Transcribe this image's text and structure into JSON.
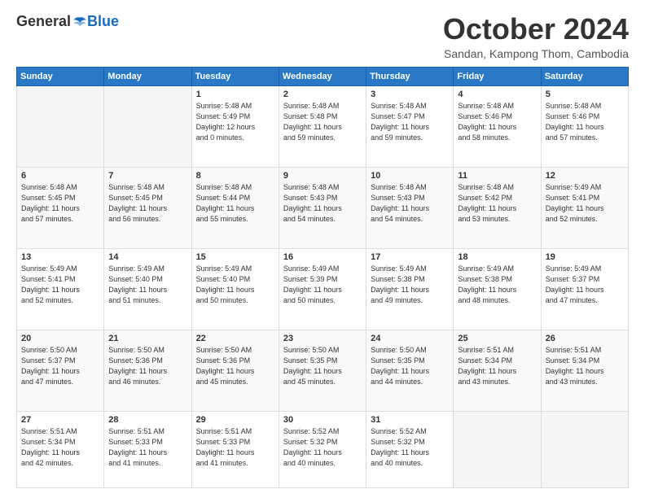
{
  "header": {
    "logo": {
      "general": "General",
      "blue": "Blue"
    },
    "title": "October 2024",
    "subtitle": "Sandan, Kampong Thom, Cambodia"
  },
  "weekdays": [
    "Sunday",
    "Monday",
    "Tuesday",
    "Wednesday",
    "Thursday",
    "Friday",
    "Saturday"
  ],
  "weeks": [
    [
      {
        "day": "",
        "info": ""
      },
      {
        "day": "",
        "info": ""
      },
      {
        "day": "1",
        "info": "Sunrise: 5:48 AM\nSunset: 5:49 PM\nDaylight: 12 hours\nand 0 minutes."
      },
      {
        "day": "2",
        "info": "Sunrise: 5:48 AM\nSunset: 5:48 PM\nDaylight: 11 hours\nand 59 minutes."
      },
      {
        "day": "3",
        "info": "Sunrise: 5:48 AM\nSunset: 5:47 PM\nDaylight: 11 hours\nand 59 minutes."
      },
      {
        "day": "4",
        "info": "Sunrise: 5:48 AM\nSunset: 5:46 PM\nDaylight: 11 hours\nand 58 minutes."
      },
      {
        "day": "5",
        "info": "Sunrise: 5:48 AM\nSunset: 5:46 PM\nDaylight: 11 hours\nand 57 minutes."
      }
    ],
    [
      {
        "day": "6",
        "info": "Sunrise: 5:48 AM\nSunset: 5:45 PM\nDaylight: 11 hours\nand 57 minutes."
      },
      {
        "day": "7",
        "info": "Sunrise: 5:48 AM\nSunset: 5:45 PM\nDaylight: 11 hours\nand 56 minutes."
      },
      {
        "day": "8",
        "info": "Sunrise: 5:48 AM\nSunset: 5:44 PM\nDaylight: 11 hours\nand 55 minutes."
      },
      {
        "day": "9",
        "info": "Sunrise: 5:48 AM\nSunset: 5:43 PM\nDaylight: 11 hours\nand 54 minutes."
      },
      {
        "day": "10",
        "info": "Sunrise: 5:48 AM\nSunset: 5:43 PM\nDaylight: 11 hours\nand 54 minutes."
      },
      {
        "day": "11",
        "info": "Sunrise: 5:48 AM\nSunset: 5:42 PM\nDaylight: 11 hours\nand 53 minutes."
      },
      {
        "day": "12",
        "info": "Sunrise: 5:49 AM\nSunset: 5:41 PM\nDaylight: 11 hours\nand 52 minutes."
      }
    ],
    [
      {
        "day": "13",
        "info": "Sunrise: 5:49 AM\nSunset: 5:41 PM\nDaylight: 11 hours\nand 52 minutes."
      },
      {
        "day": "14",
        "info": "Sunrise: 5:49 AM\nSunset: 5:40 PM\nDaylight: 11 hours\nand 51 minutes."
      },
      {
        "day": "15",
        "info": "Sunrise: 5:49 AM\nSunset: 5:40 PM\nDaylight: 11 hours\nand 50 minutes."
      },
      {
        "day": "16",
        "info": "Sunrise: 5:49 AM\nSunset: 5:39 PM\nDaylight: 11 hours\nand 50 minutes."
      },
      {
        "day": "17",
        "info": "Sunrise: 5:49 AM\nSunset: 5:38 PM\nDaylight: 11 hours\nand 49 minutes."
      },
      {
        "day": "18",
        "info": "Sunrise: 5:49 AM\nSunset: 5:38 PM\nDaylight: 11 hours\nand 48 minutes."
      },
      {
        "day": "19",
        "info": "Sunrise: 5:49 AM\nSunset: 5:37 PM\nDaylight: 11 hours\nand 47 minutes."
      }
    ],
    [
      {
        "day": "20",
        "info": "Sunrise: 5:50 AM\nSunset: 5:37 PM\nDaylight: 11 hours\nand 47 minutes."
      },
      {
        "day": "21",
        "info": "Sunrise: 5:50 AM\nSunset: 5:36 PM\nDaylight: 11 hours\nand 46 minutes."
      },
      {
        "day": "22",
        "info": "Sunrise: 5:50 AM\nSunset: 5:36 PM\nDaylight: 11 hours\nand 45 minutes."
      },
      {
        "day": "23",
        "info": "Sunrise: 5:50 AM\nSunset: 5:35 PM\nDaylight: 11 hours\nand 45 minutes."
      },
      {
        "day": "24",
        "info": "Sunrise: 5:50 AM\nSunset: 5:35 PM\nDaylight: 11 hours\nand 44 minutes."
      },
      {
        "day": "25",
        "info": "Sunrise: 5:51 AM\nSunset: 5:34 PM\nDaylight: 11 hours\nand 43 minutes."
      },
      {
        "day": "26",
        "info": "Sunrise: 5:51 AM\nSunset: 5:34 PM\nDaylight: 11 hours\nand 43 minutes."
      }
    ],
    [
      {
        "day": "27",
        "info": "Sunrise: 5:51 AM\nSunset: 5:34 PM\nDaylight: 11 hours\nand 42 minutes."
      },
      {
        "day": "28",
        "info": "Sunrise: 5:51 AM\nSunset: 5:33 PM\nDaylight: 11 hours\nand 41 minutes."
      },
      {
        "day": "29",
        "info": "Sunrise: 5:51 AM\nSunset: 5:33 PM\nDaylight: 11 hours\nand 41 minutes."
      },
      {
        "day": "30",
        "info": "Sunrise: 5:52 AM\nSunset: 5:32 PM\nDaylight: 11 hours\nand 40 minutes."
      },
      {
        "day": "31",
        "info": "Sunrise: 5:52 AM\nSunset: 5:32 PM\nDaylight: 11 hours\nand 40 minutes."
      },
      {
        "day": "",
        "info": ""
      },
      {
        "day": "",
        "info": ""
      }
    ]
  ]
}
